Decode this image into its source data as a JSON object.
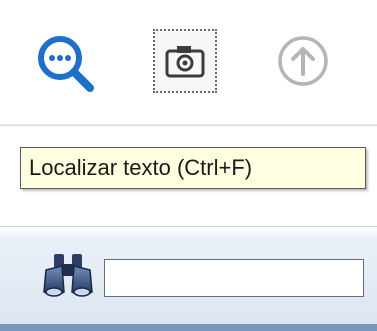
{
  "toolbar": {
    "buttons": [
      {
        "icon": "search-text-icon",
        "color": "#1e6fc9"
      },
      {
        "icon": "camera-snapshot-icon",
        "color": "#3c3c3c"
      },
      {
        "icon": "upload-arrow-icon",
        "color": "#b0b0b0",
        "disabled": true
      }
    ]
  },
  "tooltip": {
    "text": "Localizar texto (Ctrl+F)"
  },
  "find_bar": {
    "icon": "binoculars-icon",
    "input_value": "",
    "input_placeholder": ""
  },
  "colors": {
    "tooltip_bg": "#ffffe1",
    "find_bar_bg": "#dbe5f1",
    "accent": "#1e6fc9"
  }
}
